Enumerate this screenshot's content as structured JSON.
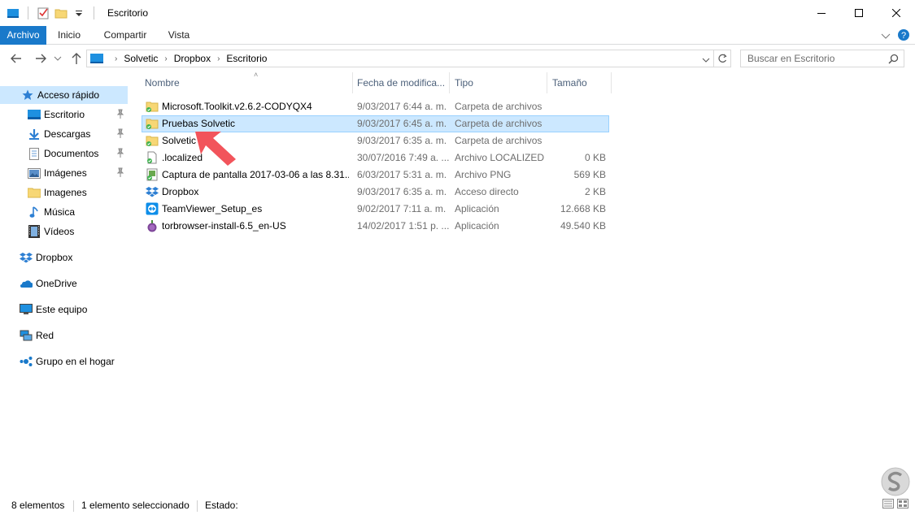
{
  "window": {
    "title": "Escritorio",
    "minimize_icon": "minimize-icon",
    "maximize_icon": "maximize-icon",
    "close_icon": "close-icon"
  },
  "ribbon": {
    "tabs": [
      {
        "label": "Archivo",
        "active": true
      },
      {
        "label": "Inicio"
      },
      {
        "label": "Compartir"
      },
      {
        "label": "Vista"
      }
    ]
  },
  "address": {
    "breadcrumbs": [
      "Solvetic",
      "Dropbox",
      "Escritorio"
    ]
  },
  "search": {
    "placeholder": "Buscar en Escritorio"
  },
  "sidebar": {
    "items": [
      {
        "label": "Acceso rápido",
        "icon": "star-icon",
        "selected": true
      },
      {
        "label": "Escritorio",
        "icon": "desktop-icon",
        "pinned": true
      },
      {
        "label": "Descargas",
        "icon": "download-icon",
        "pinned": true
      },
      {
        "label": "Documentos",
        "icon": "document-icon",
        "pinned": true
      },
      {
        "label": "Imágenes",
        "icon": "pictures-icon",
        "pinned": true
      },
      {
        "label": "Imagenes",
        "icon": "folder-icon"
      },
      {
        "label": "Música",
        "icon": "music-icon"
      },
      {
        "label": "Vídeos",
        "icon": "video-icon"
      },
      {
        "label": "Dropbox",
        "icon": "dropbox-icon"
      },
      {
        "label": "OneDrive",
        "icon": "onedrive-icon"
      },
      {
        "label": "Este equipo",
        "icon": "computer-icon"
      },
      {
        "label": "Red",
        "icon": "network-icon"
      },
      {
        "label": "Grupo en el hogar",
        "icon": "homegroup-icon"
      }
    ]
  },
  "columns": {
    "name": "Nombre",
    "date": "Fecha de modifica...",
    "type": "Tipo",
    "size": "Tamaño"
  },
  "files": [
    {
      "name": "Microsoft.Toolkit.v2.6.2-CODYQX4",
      "date": "9/03/2017 6:44 a. m.",
      "type": "Carpeta de archivos",
      "size": "",
      "icon": "folder-synced-icon"
    },
    {
      "name": "Pruebas Solvetic",
      "date": "9/03/2017 6:45 a. m.",
      "type": "Carpeta de archivos",
      "size": "",
      "icon": "folder-synced-icon",
      "selected": true
    },
    {
      "name": "Solvetic",
      "date": "9/03/2017 6:35 a. m.",
      "type": "Carpeta de archivos",
      "size": "",
      "icon": "folder-synced-icon"
    },
    {
      "name": ".localized",
      "date": "30/07/2016 7:49 a. ...",
      "type": "Archivo LOCALIZED",
      "size": "0 KB",
      "icon": "file-icon"
    },
    {
      "name": "Captura de pantalla 2017-03-06 a las 8.31....",
      "date": "6/03/2017 5:31 a. m.",
      "type": "Archivo PNG",
      "size": "569 KB",
      "icon": "image-file-icon"
    },
    {
      "name": "Dropbox",
      "date": "9/03/2017 6:35 a. m.",
      "type": "Acceso directo",
      "size": "2 KB",
      "icon": "dropbox-icon"
    },
    {
      "name": "TeamViewer_Setup_es",
      "date": "9/02/2017 7:11 a. m.",
      "type": "Aplicación",
      "size": "12.668 KB",
      "icon": "teamviewer-icon"
    },
    {
      "name": "torbrowser-install-6.5_en-US",
      "date": "14/02/2017 1:51 p. ...",
      "type": "Aplicación",
      "size": "49.540 KB",
      "icon": "torbrowser-icon"
    }
  ],
  "status": {
    "count": "8 elementos",
    "selection": "1 elemento seleccionado",
    "state": "Estado:"
  },
  "colors": {
    "accent": "#1979ca",
    "selection": "#cce8ff",
    "annotation_arrow": "#f2545b"
  }
}
